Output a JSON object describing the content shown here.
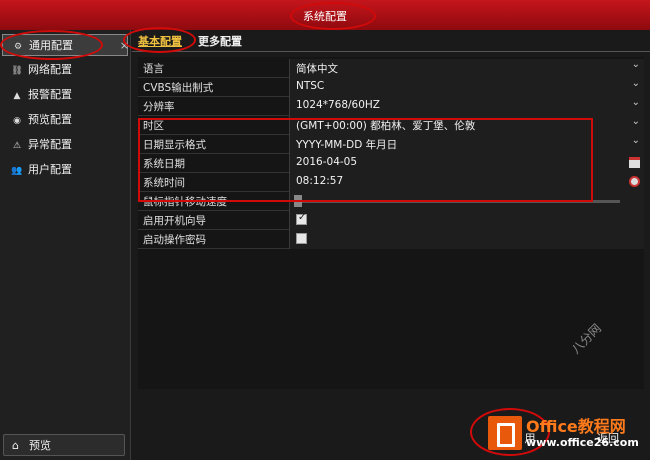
{
  "window": {
    "title": "系统配置"
  },
  "sidebar": {
    "items": [
      {
        "label": "通用配置",
        "icon": "gear-icon",
        "glyph": "⚙",
        "active": true
      },
      {
        "label": "网络配置",
        "icon": "network-icon",
        "glyph": "⛓",
        "active": false
      },
      {
        "label": "报警配置",
        "icon": "alarm-icon",
        "glyph": "▲",
        "active": false
      },
      {
        "label": "预览配置",
        "icon": "eye-icon",
        "glyph": "◉",
        "active": false
      },
      {
        "label": "异常配置",
        "icon": "warning-icon",
        "glyph": "⚠",
        "active": false
      },
      {
        "label": "用户配置",
        "icon": "users-icon",
        "glyph": "👥",
        "active": false
      }
    ],
    "close_glyph": "×",
    "preview_label": "预览",
    "preview_icon": "home-icon"
  },
  "tabs": [
    {
      "label": "基本配置",
      "active": true
    },
    {
      "label": "更多配置",
      "active": false
    }
  ],
  "settings": [
    {
      "label": "语言",
      "value": "简体中文",
      "control": "dropdown"
    },
    {
      "label": "CVBS输出制式",
      "value": "NTSC",
      "control": "dropdown"
    },
    {
      "label": "分辨率",
      "value": "1024*768/60HZ",
      "control": "dropdown"
    },
    {
      "label": "时区",
      "value": "(GMT+00:00) 都柏林、爱丁堡、伦敦",
      "control": "dropdown"
    },
    {
      "label": "日期显示格式",
      "value": "YYYY-MM-DD 年月日",
      "control": "dropdown"
    },
    {
      "label": "系统日期",
      "value": "2016-04-05",
      "control": "calendar"
    },
    {
      "label": "系统时间",
      "value": "08:12:57",
      "control": "clock"
    },
    {
      "label": "鼠标指针移动速度",
      "value": "",
      "control": "slider"
    },
    {
      "label": "启用开机向导",
      "value": "",
      "control": "checkbox",
      "checked": true
    },
    {
      "label": "启动操作密码",
      "value": "",
      "control": "checkbox",
      "checked": false
    }
  ],
  "footer": {
    "apply_label": "用",
    "back_label": "返回"
  },
  "watermark": {
    "brand": "Office教程网",
    "url": "www.office26.com",
    "side_text": "八分网"
  },
  "colors": {
    "title_bar": "#c5151c",
    "annotation_red": "#d10a0a",
    "tab_active": "#f0c040"
  }
}
